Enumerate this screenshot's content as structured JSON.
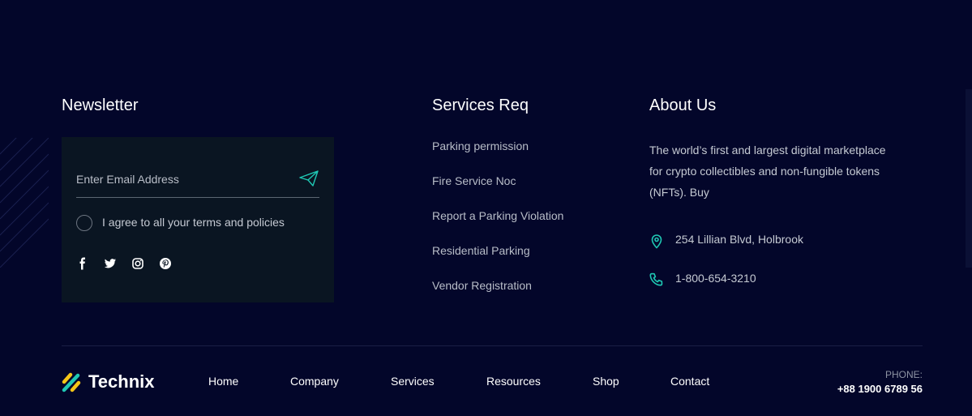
{
  "newsletter": {
    "title": "Newsletter",
    "email_placeholder": "Enter Email Address",
    "agree_label": "I agree to all your terms and policies",
    "socials": [
      "facebook-icon",
      "twitter-icon",
      "instagram-icon",
      "pinterest-icon"
    ]
  },
  "services": {
    "title": "Services Req",
    "items": [
      {
        "label": "Parking permission"
      },
      {
        "label": "Fire Service Noc"
      },
      {
        "label": "Report a Parking Violation"
      },
      {
        "label": "Residential Parking"
      },
      {
        "label": "Vendor Registration"
      }
    ]
  },
  "about": {
    "title": "About Us",
    "text": "The world’s first and largest digital marketplace for crypto collectibles and non-fungible tokens (NFTs). Buy",
    "address": "254 Lillian Blvd, Holbrook",
    "phone": "1-800-654-3210"
  },
  "footer": {
    "brand": "Technix",
    "nav": [
      {
        "label": "Home"
      },
      {
        "label": "Company"
      },
      {
        "label": "Services"
      },
      {
        "label": "Resources"
      },
      {
        "label": "Shop"
      },
      {
        "label": "Contact"
      }
    ],
    "phone_label": "PHONE:",
    "phone_value": "+88 1900 6789 56"
  },
  "colors": {
    "background": "#03062a",
    "newsletter_box": "#0a1522",
    "accent": "#1fc8b4",
    "logo_yellow": "#f5c518"
  }
}
